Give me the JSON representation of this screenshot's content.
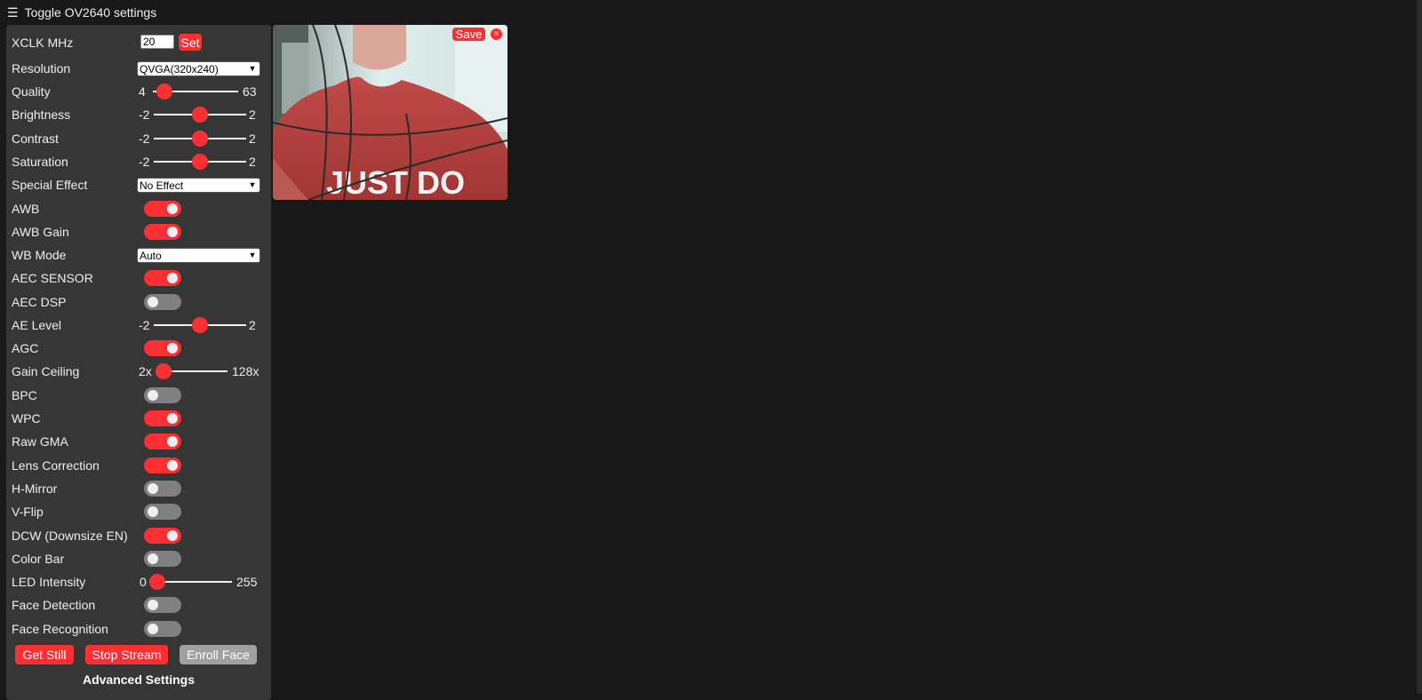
{
  "header": {
    "toggle_label": "Toggle OV2640 settings",
    "icon": "hamburger-menu-icon"
  },
  "settings": {
    "xclk": {
      "label": "XCLK MHz",
      "value": "20",
      "set_label": "Set"
    },
    "resolution": {
      "label": "Resolution",
      "selected": "QVGA(320x240)"
    },
    "quality": {
      "label": "Quality",
      "min": "4",
      "max": "63",
      "value": 10
    },
    "brightness": {
      "label": "Brightness",
      "min": "-2",
      "max": "2",
      "value": 0
    },
    "contrast": {
      "label": "Contrast",
      "min": "-2",
      "max": "2",
      "value": 0
    },
    "saturation": {
      "label": "Saturation",
      "min": "-2",
      "max": "2",
      "value": 0
    },
    "special_effect": {
      "label": "Special Effect",
      "selected": "No Effect"
    },
    "awb": {
      "label": "AWB",
      "on": true
    },
    "awb_gain": {
      "label": "AWB Gain",
      "on": true
    },
    "wb_mode": {
      "label": "WB Mode",
      "selected": "Auto"
    },
    "aec_sensor": {
      "label": "AEC SENSOR",
      "on": true
    },
    "aec_dsp": {
      "label": "AEC DSP",
      "on": false
    },
    "ae_level": {
      "label": "AE Level",
      "min": "-2",
      "max": "2",
      "value": 0
    },
    "agc": {
      "label": "AGC",
      "on": true
    },
    "gain_ceiling": {
      "label": "Gain Ceiling",
      "min": "2x",
      "max": "128x",
      "value": 0
    },
    "bpc": {
      "label": "BPC",
      "on": false
    },
    "wpc": {
      "label": "WPC",
      "on": true
    },
    "raw_gma": {
      "label": "Raw GMA",
      "on": true
    },
    "lens_correction": {
      "label": "Lens Correction",
      "on": true
    },
    "h_mirror": {
      "label": "H-Mirror",
      "on": false
    },
    "v_flip": {
      "label": "V-Flip",
      "on": false
    },
    "dcw": {
      "label": "DCW (Downsize EN)",
      "on": true
    },
    "color_bar": {
      "label": "Color Bar",
      "on": false
    },
    "led_intensity": {
      "label": "LED Intensity",
      "min": "0",
      "max": "255",
      "value": 0
    },
    "face_detection": {
      "label": "Face Detection",
      "on": false
    },
    "face_recognition": {
      "label": "Face Recognition",
      "on": false
    }
  },
  "buttons": {
    "get_still": "Get Still",
    "stop_stream": "Stop Stream",
    "enroll_face": "Enroll Face"
  },
  "advanced_label": "Advanced Settings",
  "stream": {
    "save_label": "Save",
    "close_label": "×",
    "shirt_text": "JUST DO"
  },
  "colors": {
    "accent": "#ff3034",
    "panel": "#363636",
    "background": "#181818",
    "off": "#808080"
  }
}
